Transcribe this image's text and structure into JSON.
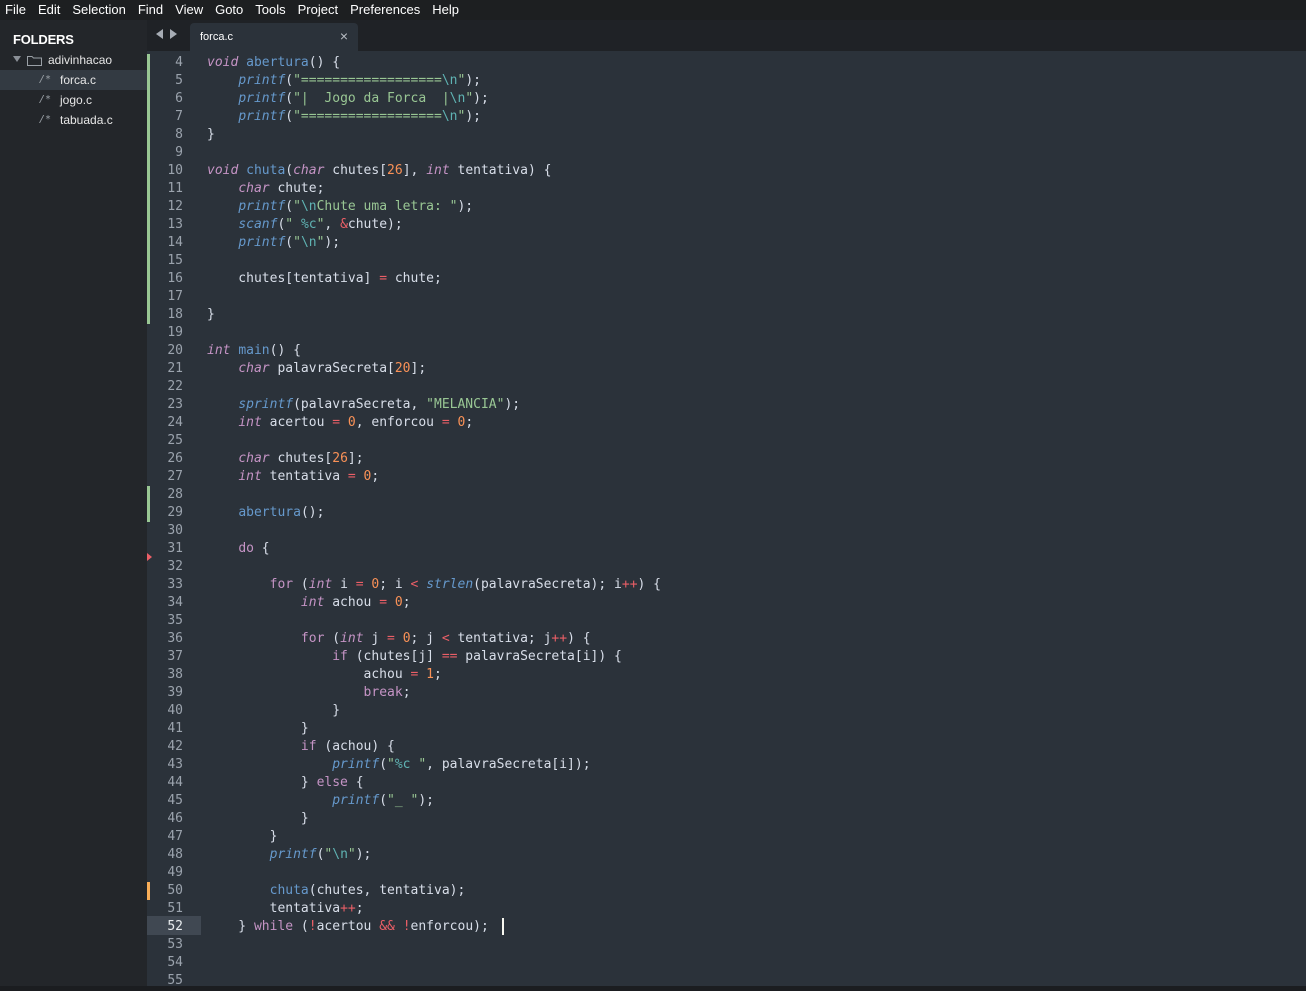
{
  "menu": [
    "File",
    "Edit",
    "Selection",
    "Find",
    "View",
    "Goto",
    "Tools",
    "Project",
    "Preferences",
    "Help"
  ],
  "sidebar": {
    "title": "FOLDERS",
    "folder": {
      "name": "adivinhacao"
    },
    "files": [
      {
        "name": "forca.c",
        "icon": "/*",
        "selected": true
      },
      {
        "name": "jogo.c",
        "icon": "/*",
        "selected": false
      },
      {
        "name": "tabuada.c",
        "icon": "/*",
        "selected": false
      }
    ]
  },
  "tabs": [
    {
      "label": "forca.c",
      "close": "×",
      "active": true
    }
  ],
  "editor": {
    "first_line": 4,
    "current_line": 52,
    "line_numbers": [
      "4",
      "5",
      "6",
      "7",
      "8",
      "9",
      "10",
      "11",
      "12",
      "13",
      "14",
      "15",
      "16",
      "17",
      "18",
      "19",
      "20",
      "21",
      "22",
      "23",
      "24",
      "25",
      "26",
      "27",
      "28",
      "29",
      "30",
      "31",
      "32",
      "33",
      "34",
      "35",
      "36",
      "37",
      "38",
      "39",
      "40",
      "41",
      "42",
      "43",
      "44",
      "45",
      "46",
      "47",
      "48",
      "49",
      "50",
      "51",
      "52",
      "53",
      "54",
      "55"
    ],
    "code_lines": [
      "void abertura() {",
      "    printf(\"==================\\n\");",
      "    printf(\"|  Jogo da Forca  |\\n\");",
      "    printf(\"==================\\n\");",
      "}",
      "",
      "void chuta(char chutes[26], int tentativa) {",
      "    char chute;",
      "    printf(\"\\nChute uma letra: \");",
      "    scanf(\" %c\", &chute);",
      "    printf(\"\\n\");",
      "",
      "    chutes[tentativa] = chute;",
      "",
      "}",
      "",
      "int main() {",
      "    char palavraSecreta[20];",
      "",
      "    sprintf(palavraSecreta, \"MELANCIA\");",
      "    int acertou = 0, enforcou = 0;",
      "",
      "    char chutes[26];",
      "    int tentativa = 0;",
      "",
      "    abertura();",
      "",
      "    do {",
      "",
      "        for (int i = 0; i < strlen(palavraSecreta); i++) {",
      "            int achou = 0;",
      "",
      "            for (int j = 0; j < tentativa; j++) {",
      "                if (chutes[j] == palavraSecreta[i]) {",
      "                    achou = 1;",
      "                    break;",
      "                }",
      "            }",
      "            if (achou) {",
      "                printf(\"%c \", palavraSecreta[i]);",
      "            } else {",
      "                printf(\"_ \");",
      "            }",
      "        }",
      "        printf(\"\\n\");",
      "",
      "        chuta(chutes, tentativa);",
      "        tentativa++;",
      "    } while (!acertou && !enforcou);",
      "",
      "",
      ""
    ]
  },
  "colors": {
    "background": "#2b323a",
    "sidebar": "#23262a",
    "keyword": "#c594c5",
    "function": "#6699cc",
    "string": "#99c794",
    "number": "#f99157",
    "operator": "#ec5f67",
    "added_marker": "#99c794",
    "modified_marker": "#f9ae58"
  }
}
